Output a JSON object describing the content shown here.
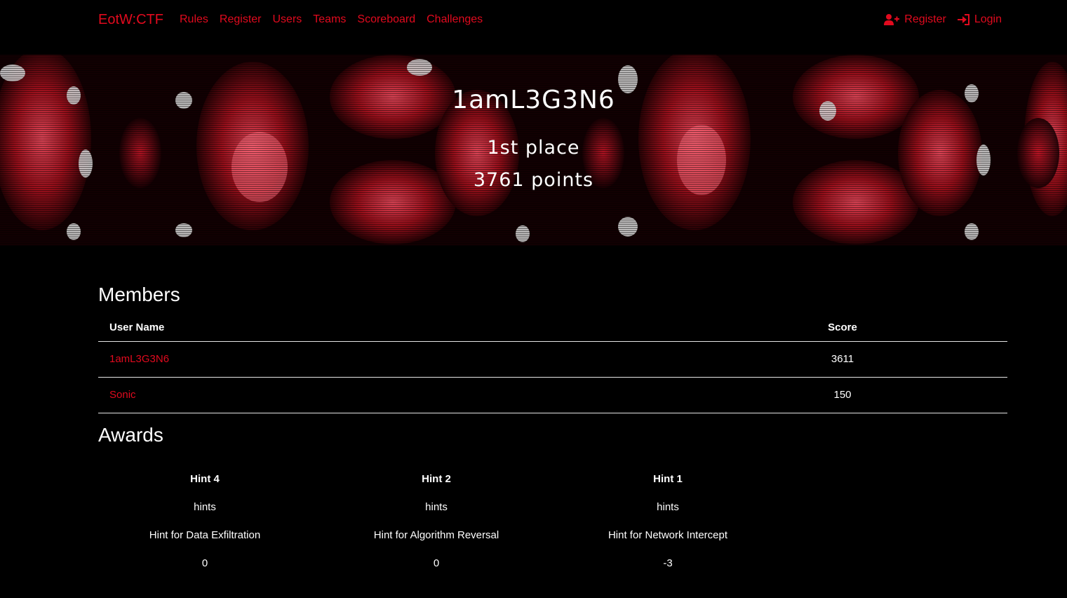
{
  "nav": {
    "brand": "EotW:CTF",
    "links": [
      "Rules",
      "Register",
      "Users",
      "Teams",
      "Scoreboard",
      "Challenges"
    ],
    "register": "Register",
    "login": "Login"
  },
  "team": {
    "name": "1amL3G3N6",
    "place": "1st place",
    "points": "3761 points"
  },
  "members": {
    "title": "Members",
    "col_name": "User Name",
    "col_score": "Score",
    "rows": [
      {
        "name": "1amL3G3N6",
        "score": "3611"
      },
      {
        "name": "Sonic",
        "score": "150"
      }
    ]
  },
  "awards": {
    "title": "Awards",
    "items": [
      {
        "name": "Hint 4",
        "category": "hints",
        "description": "Hint for Data Exfiltration",
        "value": "0"
      },
      {
        "name": "Hint 2",
        "category": "hints",
        "description": "Hint for Algorithm Reversal",
        "value": "0"
      },
      {
        "name": "Hint 1",
        "category": "hints",
        "description": "Hint for Network Intercept",
        "value": "-3"
      }
    ]
  },
  "colors": {
    "accent": "#e10a1e",
    "background": "#000000",
    "text": "#ffffff"
  }
}
